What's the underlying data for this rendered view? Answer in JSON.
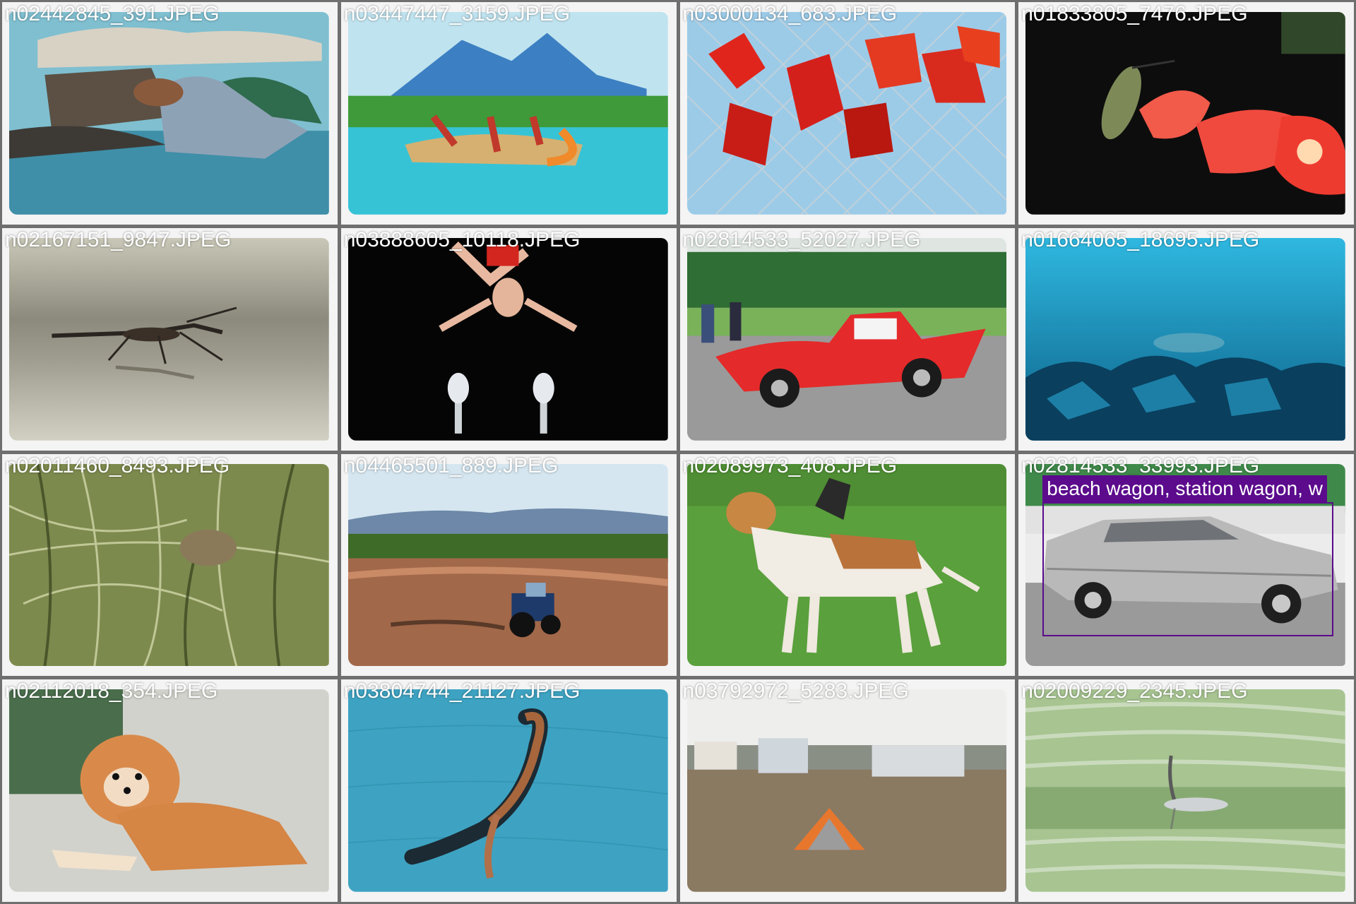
{
  "grid": {
    "tiles": [
      {
        "filename": "n02442845_391.JPEG",
        "subject": "weasel-on-rocks"
      },
      {
        "filename": "n03447447_3159.JPEG",
        "subject": "gondola-lake"
      },
      {
        "filename": "n03000134_683.JPEG",
        "subject": "red-leaves-fence"
      },
      {
        "filename": "n01833805_7476.JPEG",
        "subject": "hummingbird-feeder"
      },
      {
        "filename": "n02167151_9847.JPEG",
        "subject": "insect-reflection"
      },
      {
        "filename": "n03888605_10118.JPEG",
        "subject": "gymnast"
      },
      {
        "filename": "n02814533_52027.JPEG",
        "subject": "red-car"
      },
      {
        "filename": "n01664065_18695.JPEG",
        "subject": "underwater-turtle"
      },
      {
        "filename": "n02011460_8493.JPEG",
        "subject": "bird-in-grass"
      },
      {
        "filename": "n04465501_889.JPEG",
        "subject": "tractor-field"
      },
      {
        "filename": "n02089973_408.JPEG",
        "subject": "beagle-dog"
      },
      {
        "filename": "n02814533_33993.JPEG",
        "subject": "station-wagon"
      },
      {
        "filename": "n02112018_354.JPEG",
        "subject": "pomeranian"
      },
      {
        "filename": "n03804744_21127.JPEG",
        "subject": "pool-swimmer"
      },
      {
        "filename": "n03792972_5283.JPEG",
        "subject": "tent-campsite"
      },
      {
        "filename": "n02009229_2345.JPEG",
        "subject": "heron-water"
      }
    ]
  },
  "detection": {
    "label": "beach wagon, station wagon, w",
    "color": "#5b0b8c"
  },
  "colors": {
    "background": "#6f6f6f",
    "filename_text": "#ffffff"
  }
}
